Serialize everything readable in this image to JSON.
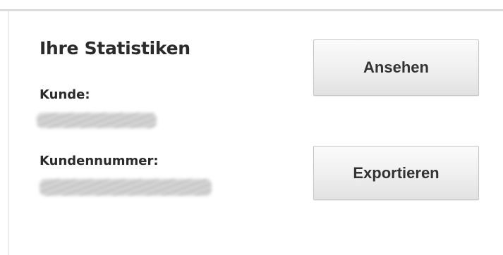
{
  "stats": {
    "title": "Ihre Statistiken",
    "customer_label": "Kunde:",
    "customer_number_label": "Kundennummer:"
  },
  "actions": {
    "view_label": "Ansehen",
    "export_label": "Exportieren"
  }
}
